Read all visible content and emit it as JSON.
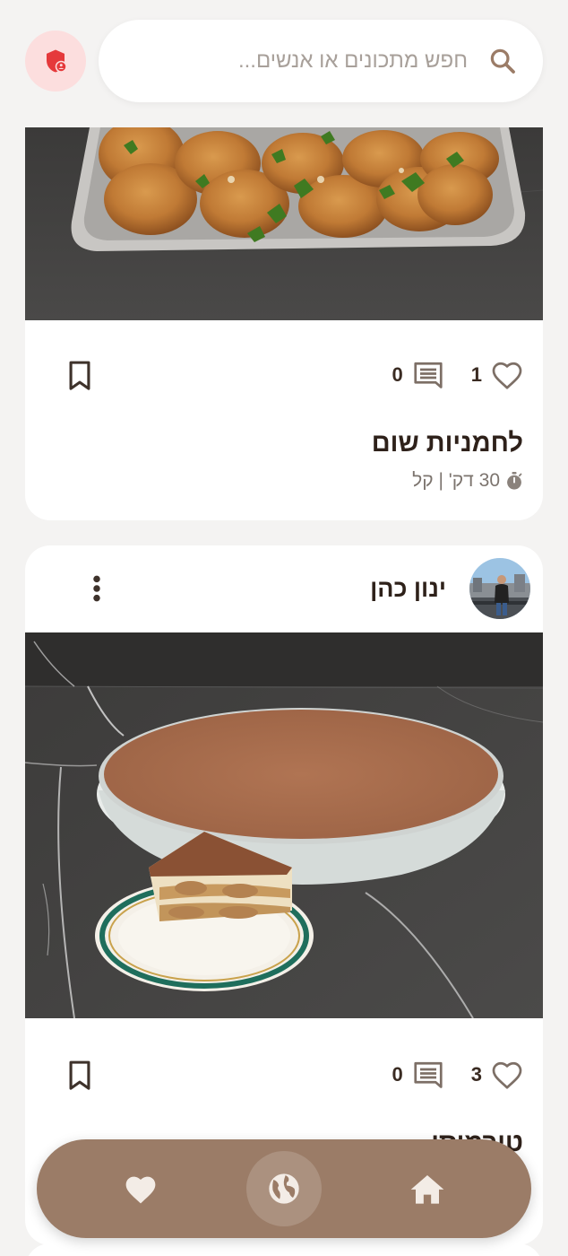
{
  "search": {
    "placeholder": "חפש מתכונים או אנשים..."
  },
  "feed": [
    {
      "likes": "1",
      "comments": "0",
      "title": "לחמניות שום",
      "meta": "30 דק' | קל"
    },
    {
      "author": "ינון כהן",
      "likes": "3",
      "comments": "0",
      "title": "טירמיסו"
    }
  ],
  "icons": {
    "shield": "admin-shield-icon",
    "search": "search-icon",
    "like": "heart-outline-icon",
    "comment": "comment-icon",
    "bookmark": "bookmark-icon",
    "more": "more-vertical-icon",
    "timer": "timer-icon",
    "nav_favorites": "heart-icon",
    "nav_explore": "globe-icon",
    "nav_home": "home-icon"
  },
  "colors": {
    "background": "#f4f3f2",
    "nav": "#9b7c67",
    "shield_bg": "#fcdede",
    "shield": "#e5393b",
    "text": "#3a2b22"
  }
}
